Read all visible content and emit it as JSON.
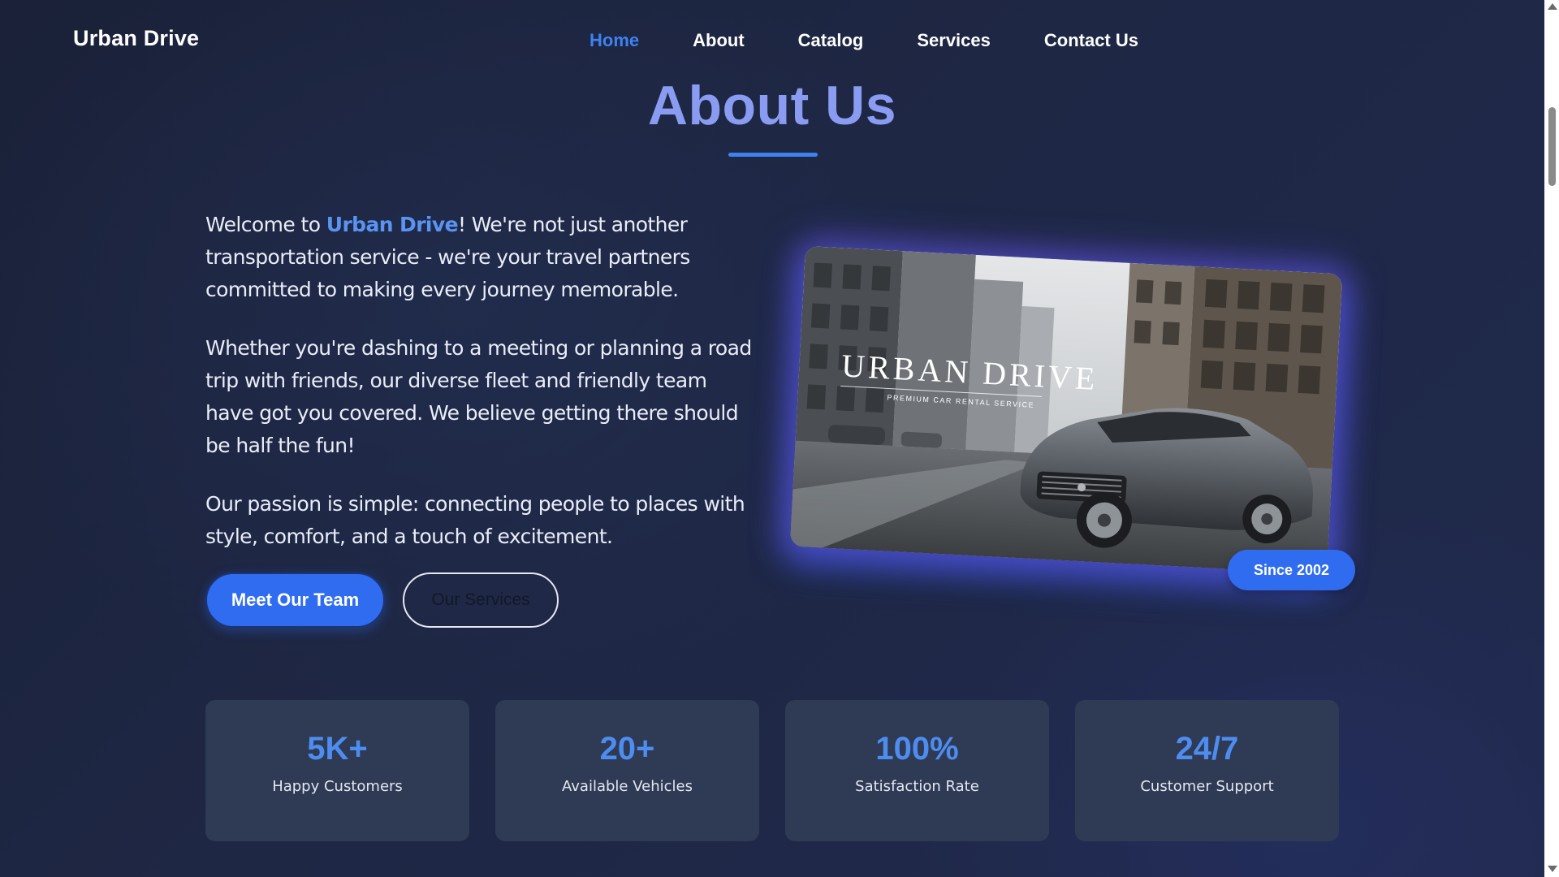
{
  "header": {
    "brand": "Urban Drive",
    "nav": [
      {
        "label": "Home",
        "active": true
      },
      {
        "label": "About",
        "active": false
      },
      {
        "label": "Catalog",
        "active": false
      },
      {
        "label": "Services",
        "active": false
      },
      {
        "label": "Contact Us",
        "active": false
      }
    ]
  },
  "about": {
    "title": "About Us",
    "intro": {
      "before": "Welcome to ",
      "highlight": "Urban Drive",
      "after": "! We're not just another transportation service - we're your travel partners committed to making every journey memorable."
    },
    "paragraph2": "Whether you're dashing to a meeting or planning a road trip with friends, our diverse fleet and friendly team have got you covered. We believe getting there should be half the fun!",
    "paragraph3": "Our passion is simple: connecting people to places with style, comfort, and a touch of excitement.",
    "buttons": {
      "primary": "Meet Our Team",
      "secondary": "Our Services"
    },
    "image": {
      "logo_text": "URBAN DRIVE",
      "logo_tagline": "PREMIUM CAR RENTAL SERVICE",
      "badge": "Since 2002"
    }
  },
  "stats": [
    {
      "value": "5K+",
      "label": "Happy Customers"
    },
    {
      "value": "20+",
      "label": "Available Vehicles"
    },
    {
      "value": "100%",
      "label": "Satisfaction Rate"
    },
    {
      "value": "24/7",
      "label": "Customer Support"
    }
  ],
  "colors": {
    "accent": "#3d82f0",
    "title": "#8a9cf2",
    "background": "#1e2744",
    "card": "#2f3a55"
  }
}
